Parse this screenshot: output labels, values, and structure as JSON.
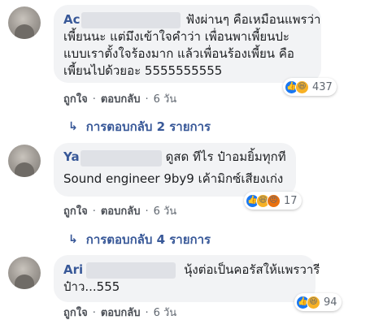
{
  "comments": [
    {
      "name": "Ac",
      "lines": [
        "ฟังผ่านๆ คือเหมือนแพรว่า",
        "เพี้ยนนะ แต่มึงเข้าใจคำว่า เพื่อนพาเพี้ยนปะ",
        "แบบเราตั้งใจร้องมาก แล้วเพื่อนร้องเพี้ยน คือ",
        "เพี้ยนไปด้วยอะ 5555555555"
      ],
      "reaction_count": "437",
      "reaction_icons": [
        "like-icon",
        "haha-icon"
      ],
      "actions": {
        "like": "ถูกใจ",
        "reply": "ตอบกลับ",
        "time": "6 วัน"
      },
      "replies_label": "การตอบกลับ 2 รายการ"
    },
    {
      "name": "Ya",
      "lines": [
        "ดูสด ทีไร ป๋าอมยิ้มทุกที",
        "Sound engineer 9by9 เค้ามิกซ์เสียงเก่ง"
      ],
      "reaction_count": "17",
      "reaction_icons": [
        "like-icon",
        "haha-icon",
        "angry-icon"
      ],
      "actions": {
        "like": "ถูกใจ",
        "reply": "ตอบกลับ",
        "time": "6 วัน"
      },
      "replies_label": "การตอบกลับ 4 รายการ"
    },
    {
      "name": "Ari",
      "lines": [
        "นุ้งต่อเป็นคอรัสให้แพรวารี",
        "ป๋าว...555"
      ],
      "reaction_count": "94",
      "reaction_icons": [
        "like-icon",
        "haha-icon"
      ],
      "actions": {
        "like": "ถูกใจ",
        "reply": "ตอบกลับ",
        "time": "6 วัน"
      }
    }
  ],
  "colors": {
    "link": "#385898",
    "bubble": "#f2f3f5",
    "like": "#1877f2",
    "haha": "#f7b125",
    "angry": "#e9710f",
    "meta": "#606770"
  }
}
